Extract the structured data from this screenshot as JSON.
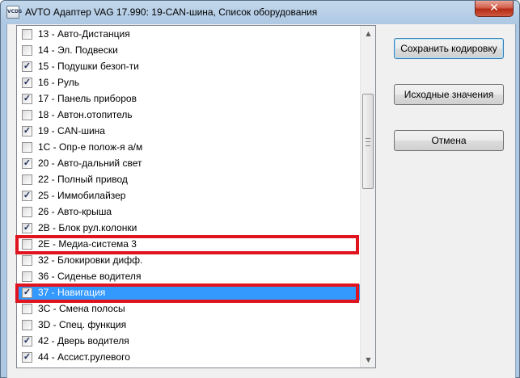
{
  "window": {
    "title": "AVTO Адаптер VAG 17.990: 19-CAN-шина,  Список оборудования",
    "icon_text": "VCDS",
    "close_symbol": "✕"
  },
  "list": {
    "items": [
      {
        "label": "13 - Авто-Дистанция",
        "checked": false,
        "selected": false
      },
      {
        "label": "14 - Эл. Подвески",
        "checked": false,
        "selected": false
      },
      {
        "label": "15 - Подушки безоп-ти",
        "checked": true,
        "selected": false
      },
      {
        "label": "16 - Руль",
        "checked": true,
        "selected": false
      },
      {
        "label": "17 - Панель приборов",
        "checked": true,
        "selected": false
      },
      {
        "label": "18 - Автон.отопитель",
        "checked": false,
        "selected": false
      },
      {
        "label": "19 - CAN-шина",
        "checked": true,
        "selected": false
      },
      {
        "label": "1C - Опр-е полож-я а/м",
        "checked": false,
        "selected": false
      },
      {
        "label": "20 - Авто-дальний свет",
        "checked": true,
        "selected": false
      },
      {
        "label": "22 - Полный привод",
        "checked": false,
        "selected": false
      },
      {
        "label": "25 - Иммобилайзер",
        "checked": true,
        "selected": false
      },
      {
        "label": "26 - Авто-крыша",
        "checked": false,
        "selected": false
      },
      {
        "label": "2B - Блок рул.колонки",
        "checked": true,
        "selected": false
      },
      {
        "label": "2E - Медиа-система 3",
        "checked": false,
        "selected": false
      },
      {
        "label": "32 - Блокировки дифф.",
        "checked": false,
        "selected": false
      },
      {
        "label": "36 - Сиденье водителя",
        "checked": false,
        "selected": false
      },
      {
        "label": "37 - Навигация",
        "checked": true,
        "selected": true
      },
      {
        "label": "3C - Смена полосы",
        "checked": false,
        "selected": false
      },
      {
        "label": "3D - Спец. функция",
        "checked": false,
        "selected": false
      },
      {
        "label": "42 - Дверь водителя",
        "checked": true,
        "selected": false
      },
      {
        "label": "44 - Ассист.рулевого",
        "checked": true,
        "selected": false
      }
    ]
  },
  "scrollbar": {
    "up_symbol": "▲",
    "down_symbol": "▼"
  },
  "buttons": {
    "save": "Сохранить кодировку",
    "defaults": "Исходные значения",
    "cancel": "Отмена"
  },
  "colors": {
    "selection": "#3399ff",
    "highlight_box": "#e0141e"
  }
}
